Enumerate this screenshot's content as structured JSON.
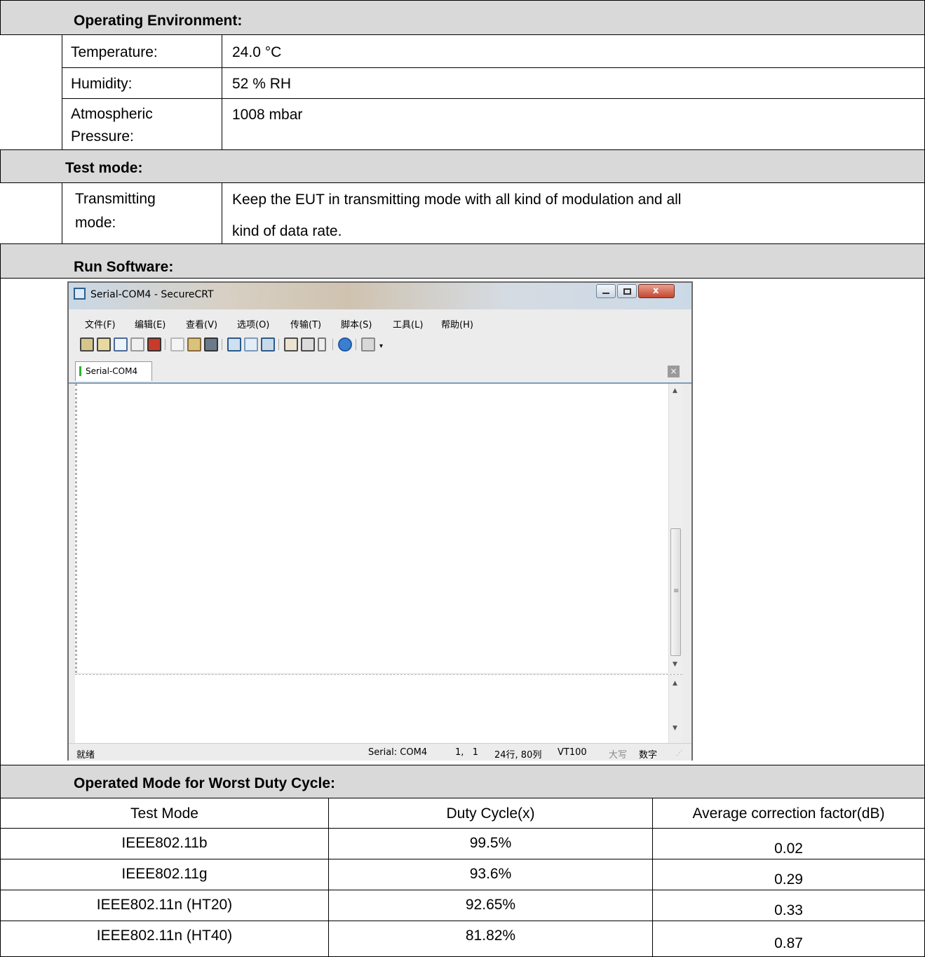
{
  "env": {
    "title": "Operating Environment:",
    "rows": [
      {
        "label": "Temperature:",
        "value": "24.0 °C"
      },
      {
        "label": "Humidity:",
        "value": "52 % RH"
      },
      {
        "label_line1": "Atmospheric",
        "label_line2": "Pressure:",
        "value": "1008 mbar"
      }
    ]
  },
  "test_mode": {
    "title": "Test mode:",
    "label_line1": "Transmitting",
    "label_line2": "mode:",
    "value_line1": "Keep the EUT in transmitting mode with all kind of modulation and all",
    "value_line2": "kind of data rate."
  },
  "run_software": {
    "title": "Run Software:",
    "window": {
      "title": "Serial-COM4 - SecureCRT",
      "menus": [
        "文件(F)",
        "编辑(E)",
        "查看(V)",
        "选项(O)",
        "传输(T)",
        "脚本(S)",
        "工具(L)",
        "帮助(H)"
      ],
      "tab": "Serial-COM4",
      "status": {
        "ready": "就绪",
        "connection": "Serial: COM4",
        "cursor": "1,   1",
        "size": "24行, 80列",
        "emulation": "VT100",
        "caps": "大写",
        "num": "数字"
      }
    }
  },
  "duty": {
    "title": "Operated Mode for Worst Duty Cycle:",
    "headers": [
      "Test Mode",
      "Duty Cycle(x)",
      "Average correction factor(dB)"
    ],
    "rows": [
      [
        "IEEE802.11b",
        "99.5%",
        "0.02"
      ],
      [
        "IEEE802.11g",
        "93.6%",
        "0.29"
      ],
      [
        "IEEE802.11n (HT20)",
        "92.65%",
        "0.33"
      ],
      [
        "IEEE802.11n (HT40)",
        "81.82%",
        "0.87"
      ]
    ]
  }
}
